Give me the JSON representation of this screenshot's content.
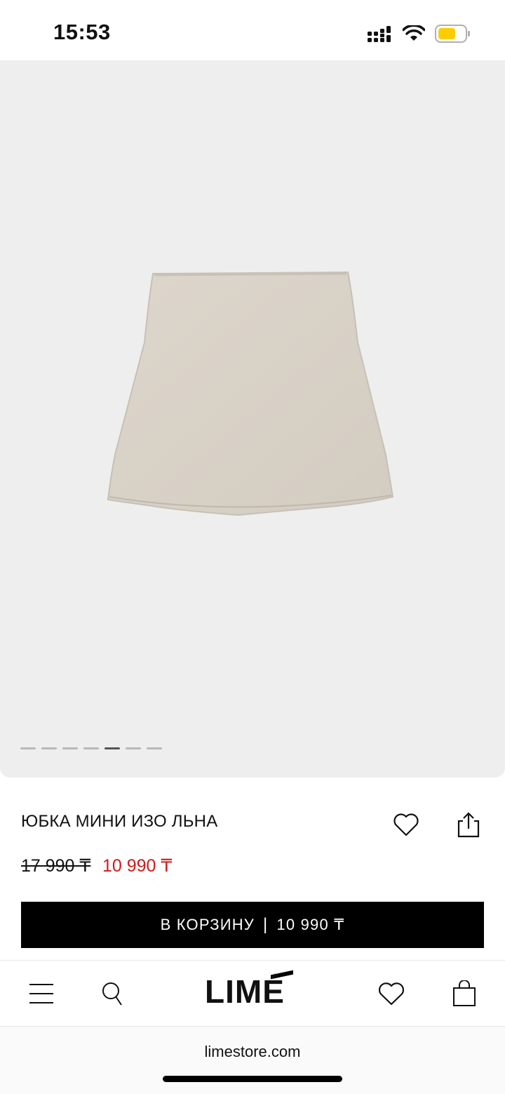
{
  "status_bar": {
    "time": "15:53",
    "battery_color": "#ffcc00"
  },
  "gallery": {
    "image_count": 7,
    "active_index": 4,
    "background": "#eeeeee"
  },
  "product": {
    "title": "ЮБКА МИНИ ИЗО ЛЬНА",
    "old_price": "17 990 ₸",
    "new_price": "10 990 ₸",
    "sale_color": "#d11a1a"
  },
  "cart_button": {
    "label": "В КОРЗИНУ",
    "separator": "|",
    "price": "10 990 ₸"
  },
  "nav": {
    "logo": "LIMÉ",
    "icons": [
      "menu-icon",
      "search-icon",
      "heart-icon",
      "bag-icon"
    ]
  },
  "browser": {
    "url": "limestore.com"
  }
}
